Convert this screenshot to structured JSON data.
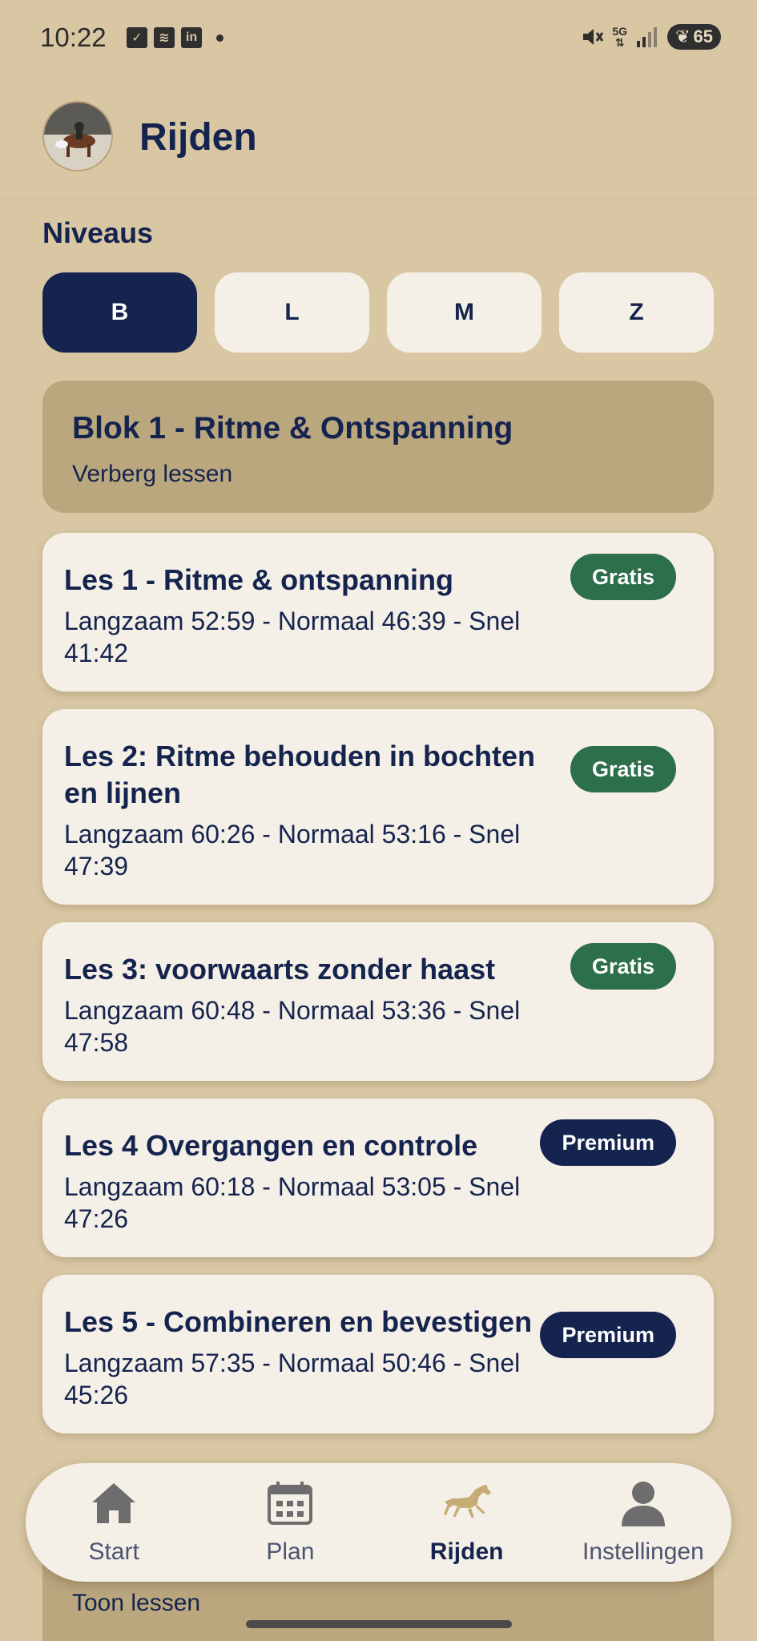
{
  "status_bar": {
    "time": "10:22",
    "battery": "65",
    "network": "5G",
    "left_icons": [
      "check-notification-icon",
      "layers-notification-icon",
      "linkedin-notification-icon"
    ],
    "right_icons": [
      "mute-icon",
      "network-icon",
      "signal-icon",
      "battery-icon"
    ]
  },
  "header": {
    "title": "Rijden"
  },
  "levels": {
    "label": "Niveaus",
    "items": [
      {
        "label": "B",
        "active": true
      },
      {
        "label": "L",
        "active": false
      },
      {
        "label": "M",
        "active": false
      },
      {
        "label": "Z",
        "active": false
      }
    ]
  },
  "blok1": {
    "title": "Blok 1 - Ritme & Ontspanning",
    "toggle": "Verberg lessen"
  },
  "lessons": [
    {
      "title": "Les 1 - Ritme & ontspanning",
      "times": "Langzaam 52:59 - Normaal 46:39 - Snel 41:42",
      "badge": "Gratis"
    },
    {
      "title": "Les 2: Ritme behouden in bochten en lijnen",
      "times": "Langzaam 60:26 - Normaal 53:16 - Snel 47:39",
      "badge": "Gratis"
    },
    {
      "title": "Les 3: voorwaarts zonder haast",
      "times": "Langzaam 60:48 - Normaal 53:36 - Snel 47:58",
      "badge": "Gratis"
    },
    {
      "title": "Les 4 Overgangen en controle",
      "times": "Langzaam 60:18 - Normaal 53:05 - Snel 47:26",
      "badge": "Premium"
    },
    {
      "title": "Les 5 - Combineren en bevestigen",
      "times": "Langzaam 57:35 - Normaal 50:46 - Snel 45:26",
      "badge": "Premium"
    }
  ],
  "blok2": {
    "toggle": "Toon lessen"
  },
  "bottom_nav": [
    {
      "label": "Start",
      "icon": "home-icon",
      "active": false
    },
    {
      "label": "Plan",
      "icon": "calendar-icon",
      "active": false
    },
    {
      "label": "Rijden",
      "icon": "horse-icon",
      "active": true
    },
    {
      "label": "Instellingen",
      "icon": "person-icon",
      "active": false
    }
  ],
  "colors": {
    "background": "#d9c7a4",
    "navy": "#15244f",
    "card": "#f5f0e7",
    "blok": "#bba77e",
    "gratis": "#2d6e4b"
  }
}
